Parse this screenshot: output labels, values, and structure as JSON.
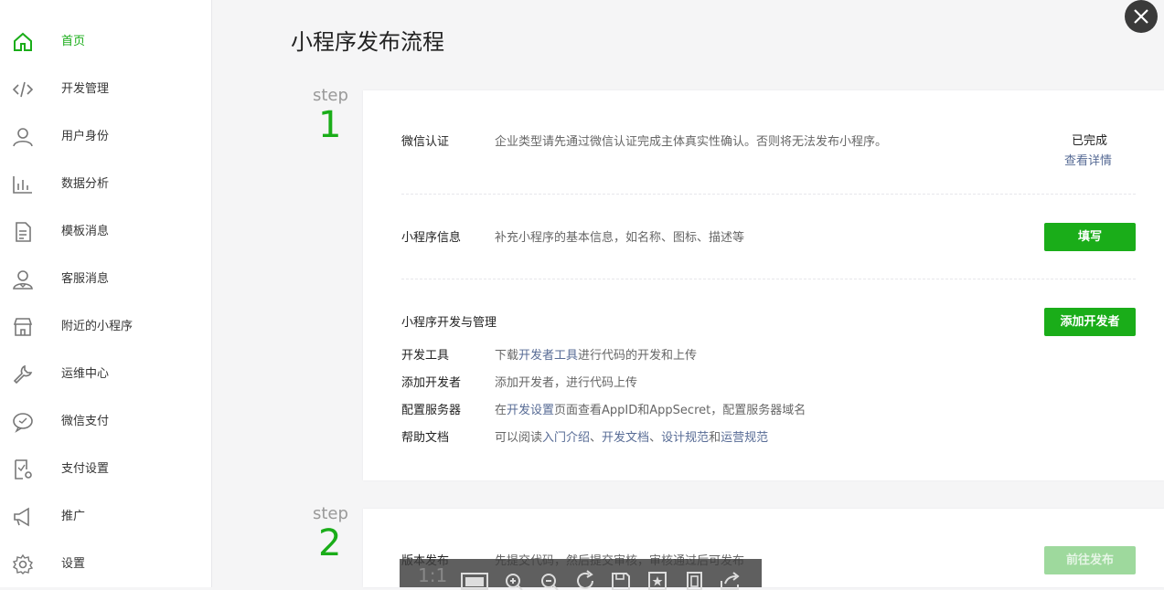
{
  "sidebar": {
    "items": [
      {
        "label": "首页",
        "icon": "home-icon",
        "active": true
      },
      {
        "label": "开发管理",
        "icon": "code-icon"
      },
      {
        "label": "用户身份",
        "icon": "user-icon"
      },
      {
        "label": "数据分析",
        "icon": "bar-chart-icon"
      },
      {
        "label": "模板消息",
        "icon": "document-icon"
      },
      {
        "label": "客服消息",
        "icon": "customer-service-icon"
      },
      {
        "label": "附近的小程序",
        "icon": "store-icon"
      },
      {
        "label": "运维中心",
        "icon": "wrench-icon"
      },
      {
        "label": "微信支付",
        "icon": "chat-bubble-icon"
      },
      {
        "label": "支付设置",
        "icon": "payment-settings-icon"
      },
      {
        "label": "推广",
        "icon": "megaphone-icon"
      },
      {
        "label": "设置",
        "icon": "gear-icon"
      }
    ]
  },
  "page": {
    "title": "小程序发布流程"
  },
  "step1": {
    "word": "step",
    "number": "1",
    "verify": {
      "title": "微信认证",
      "desc": "企业类型请先通过微信认证完成主体真实性确认。否则将无法发布小程序。",
      "status": "已完成",
      "detail_link": "查看详情"
    },
    "info": {
      "title": "小程序信息",
      "desc": "补充小程序的基本信息，如名称、图标、描述等",
      "button": "填写"
    },
    "dev": {
      "title": "小程序开发与管理",
      "button": "添加开发者",
      "tools": {
        "label": "开发工具",
        "pre": "下载",
        "link": "开发者工具",
        "post": "进行代码的开发和上传"
      },
      "add_dev": {
        "label": "添加开发者",
        "text": "添加开发者，进行代码上传"
      },
      "server": {
        "label": "配置服务器",
        "pre": "在",
        "link": "开发设置",
        "post": "页面查看AppID和AppSecret，配置服务器域名"
      },
      "help": {
        "label": "帮助文档",
        "pre": "可以阅读",
        "link1": "入门介绍",
        "sep1": "、",
        "link2": "开发文档",
        "sep2": "、",
        "link3": "设计规范",
        "and": "和",
        "link4": "运营规范"
      }
    }
  },
  "step2": {
    "word": "step",
    "number": "2",
    "release": {
      "title": "版本发布",
      "desc": "先提交代码，然后提交审核，审核通过后可发布",
      "button": "前往发布"
    }
  },
  "viewer_toolbar": {
    "ratio": "1:1",
    "icons": [
      "fit-screen-icon",
      "zoom-in-icon",
      "zoom-out-icon",
      "rotate-icon",
      "save-icon",
      "favorite-icon",
      "fullscreen-icon",
      "share-icon"
    ]
  },
  "colors": {
    "accent": "#1aad19",
    "link": "#576b95",
    "disabled_button": "#9ed99d"
  }
}
